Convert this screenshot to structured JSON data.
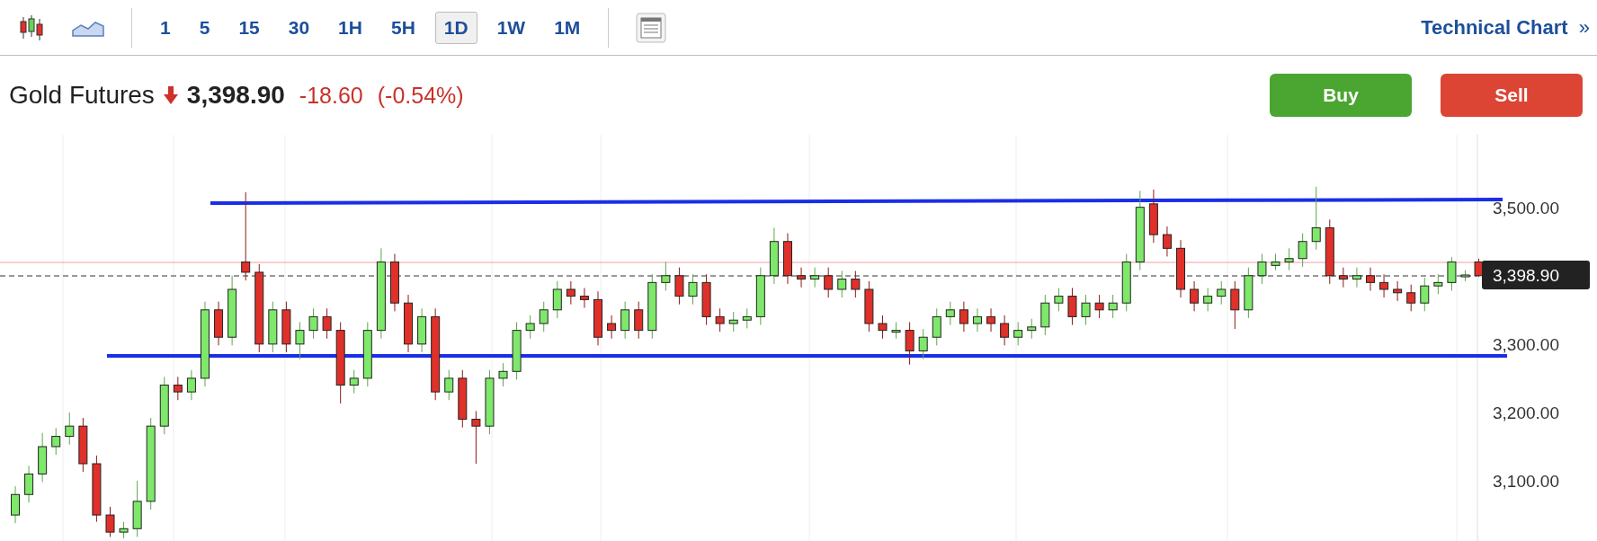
{
  "toolbar": {
    "intervals": [
      {
        "label": "1",
        "selected": false
      },
      {
        "label": "5",
        "selected": false
      },
      {
        "label": "15",
        "selected": false
      },
      {
        "label": "30",
        "selected": false
      },
      {
        "label": "1H",
        "selected": false
      },
      {
        "label": "5H",
        "selected": false
      },
      {
        "label": "1D",
        "selected": true
      },
      {
        "label": "1W",
        "selected": false
      },
      {
        "label": "1M",
        "selected": false
      }
    ],
    "link": {
      "label": "Technical Chart",
      "chevron": "»"
    }
  },
  "quote": {
    "name": "Gold Futures",
    "price": "3,398.90",
    "change": "-18.60",
    "change_percent": "(-0.54%)"
  },
  "actions": [
    {
      "kind": "buy",
      "label": "Buy"
    },
    {
      "kind": "sell",
      "label": "Sell"
    }
  ],
  "chart": {
    "last_price_label": "3,398.90",
    "chart_data": {
      "type": "candlestick",
      "ylim": [
        3012,
        3606
      ],
      "ohlc": [
        [
          3050,
          3092,
          3038,
          3080
        ],
        [
          3080,
          3122,
          3068,
          3110
        ],
        [
          3110,
          3170,
          3098,
          3150
        ],
        [
          3150,
          3177,
          3138,
          3165
        ],
        [
          3165,
          3200,
          3153,
          3180
        ],
        [
          3180,
          3192,
          3113,
          3125
        ],
        [
          3125,
          3137,
          3040,
          3050
        ],
        [
          3050,
          3062,
          3018,
          3025
        ],
        [
          3025,
          3040,
          3016,
          3030
        ],
        [
          3030,
          3100,
          3018,
          3070
        ],
        [
          3070,
          3192,
          3058,
          3180
        ],
        [
          3180,
          3252,
          3168,
          3240
        ],
        [
          3240,
          3252,
          3218,
          3230
        ],
        [
          3230,
          3262,
          3218,
          3250
        ],
        [
          3250,
          3362,
          3238,
          3350
        ],
        [
          3350,
          3362,
          3298,
          3310
        ],
        [
          3310,
          3400,
          3298,
          3380
        ],
        [
          3420,
          3522,
          3393,
          3405
        ],
        [
          3405,
          3417,
          3288,
          3300
        ],
        [
          3300,
          3362,
          3288,
          3350
        ],
        [
          3350,
          3362,
          3288,
          3300
        ],
        [
          3300,
          3332,
          3278,
          3320
        ],
        [
          3320,
          3352,
          3308,
          3340
        ],
        [
          3340,
          3352,
          3308,
          3320
        ],
        [
          3320,
          3332,
          3213,
          3240
        ],
        [
          3240,
          3262,
          3228,
          3250
        ],
        [
          3250,
          3332,
          3238,
          3320
        ],
        [
          3320,
          3440,
          3308,
          3420
        ],
        [
          3420,
          3432,
          3348,
          3360
        ],
        [
          3360,
          3372,
          3288,
          3300
        ],
        [
          3300,
          3352,
          3288,
          3340
        ],
        [
          3340,
          3352,
          3218,
          3230
        ],
        [
          3230,
          3262,
          3218,
          3250
        ],
        [
          3250,
          3262,
          3178,
          3190
        ],
        [
          3190,
          3202,
          3125,
          3180
        ],
        [
          3180,
          3262,
          3168,
          3250
        ],
        [
          3250,
          3272,
          3238,
          3260
        ],
        [
          3260,
          3332,
          3248,
          3320
        ],
        [
          3320,
          3342,
          3308,
          3330
        ],
        [
          3330,
          3362,
          3318,
          3350
        ],
        [
          3350,
          3392,
          3338,
          3380
        ],
        [
          3380,
          3392,
          3358,
          3370
        ],
        [
          3370,
          3382,
          3353,
          3365
        ],
        [
          3365,
          3377,
          3298,
          3310
        ],
        [
          3330,
          3342,
          3308,
          3320
        ],
        [
          3320,
          3362,
          3308,
          3350
        ],
        [
          3350,
          3362,
          3308,
          3320
        ],
        [
          3320,
          3402,
          3308,
          3390
        ],
        [
          3390,
          3420,
          3378,
          3400
        ],
        [
          3400,
          3412,
          3358,
          3370
        ],
        [
          3370,
          3402,
          3358,
          3390
        ],
        [
          3390,
          3402,
          3328,
          3340
        ],
        [
          3340,
          3352,
          3318,
          3330
        ],
        [
          3330,
          3347,
          3318,
          3335
        ],
        [
          3335,
          3352,
          3323,
          3340
        ],
        [
          3340,
          3412,
          3328,
          3400
        ],
        [
          3400,
          3470,
          3388,
          3450
        ],
        [
          3450,
          3462,
          3388,
          3400
        ],
        [
          3400,
          3412,
          3383,
          3395
        ],
        [
          3395,
          3412,
          3383,
          3400
        ],
        [
          3400,
          3412,
          3368,
          3380
        ],
        [
          3380,
          3407,
          3368,
          3395
        ],
        [
          3395,
          3407,
          3368,
          3380
        ],
        [
          3380,
          3392,
          3318,
          3330
        ],
        [
          3330,
          3342,
          3308,
          3320
        ],
        [
          3318,
          3332,
          3308,
          3320
        ],
        [
          3320,
          3332,
          3270,
          3290
        ],
        [
          3290,
          3322,
          3278,
          3310
        ],
        [
          3310,
          3352,
          3298,
          3340
        ],
        [
          3340,
          3362,
          3328,
          3350
        ],
        [
          3350,
          3362,
          3318,
          3330
        ],
        [
          3330,
          3352,
          3318,
          3340
        ],
        [
          3340,
          3352,
          3318,
          3330
        ],
        [
          3330,
          3342,
          3298,
          3310
        ],
        [
          3310,
          3332,
          3298,
          3320
        ],
        [
          3320,
          3337,
          3308,
          3325
        ],
        [
          3325,
          3372,
          3313,
          3360
        ],
        [
          3360,
          3382,
          3348,
          3370
        ],
        [
          3370,
          3382,
          3328,
          3340
        ],
        [
          3340,
          3372,
          3328,
          3360
        ],
        [
          3360,
          3372,
          3338,
          3350
        ],
        [
          3350,
          3372,
          3338,
          3360
        ],
        [
          3360,
          3432,
          3348,
          3420
        ],
        [
          3420,
          3524,
          3408,
          3500
        ],
        [
          3505,
          3526,
          3448,
          3460
        ],
        [
          3460,
          3472,
          3428,
          3440
        ],
        [
          3440,
          3452,
          3368,
          3380
        ],
        [
          3380,
          3392,
          3348,
          3360
        ],
        [
          3360,
          3382,
          3348,
          3370
        ],
        [
          3370,
          3392,
          3358,
          3380
        ],
        [
          3380,
          3392,
          3322,
          3350
        ],
        [
          3350,
          3412,
          3338,
          3400
        ],
        [
          3400,
          3432,
          3388,
          3420
        ],
        [
          3415,
          3432,
          3408,
          3420
        ],
        [
          3420,
          3440,
          3408,
          3425
        ],
        [
          3425,
          3462,
          3413,
          3450
        ],
        [
          3450,
          3530,
          3438,
          3470
        ],
        [
          3470,
          3482,
          3388,
          3400
        ],
        [
          3400,
          3412,
          3383,
          3395
        ],
        [
          3395,
          3412,
          3383,
          3400
        ],
        [
          3400,
          3412,
          3378,
          3390
        ],
        [
          3390,
          3402,
          3368,
          3380
        ],
        [
          3380,
          3392,
          3363,
          3375
        ],
        [
          3375,
          3387,
          3348,
          3360
        ],
        [
          3360,
          3397,
          3348,
          3385
        ],
        [
          3385,
          3402,
          3373,
          3390
        ],
        [
          3390,
          3427,
          3378,
          3420
        ],
        [
          3400,
          3408,
          3392,
          3401
        ],
        [
          3420,
          3425,
          3398,
          3400
        ]
      ],
      "yticks": [
        {
          "value": 3500,
          "label": "3,500.00"
        },
        {
          "value": 3300,
          "label": "3,300.00"
        },
        {
          "value": 3200,
          "label": "3,200.00"
        },
        {
          "value": 3100,
          "label": "3,100.00"
        }
      ]
    }
  }
}
